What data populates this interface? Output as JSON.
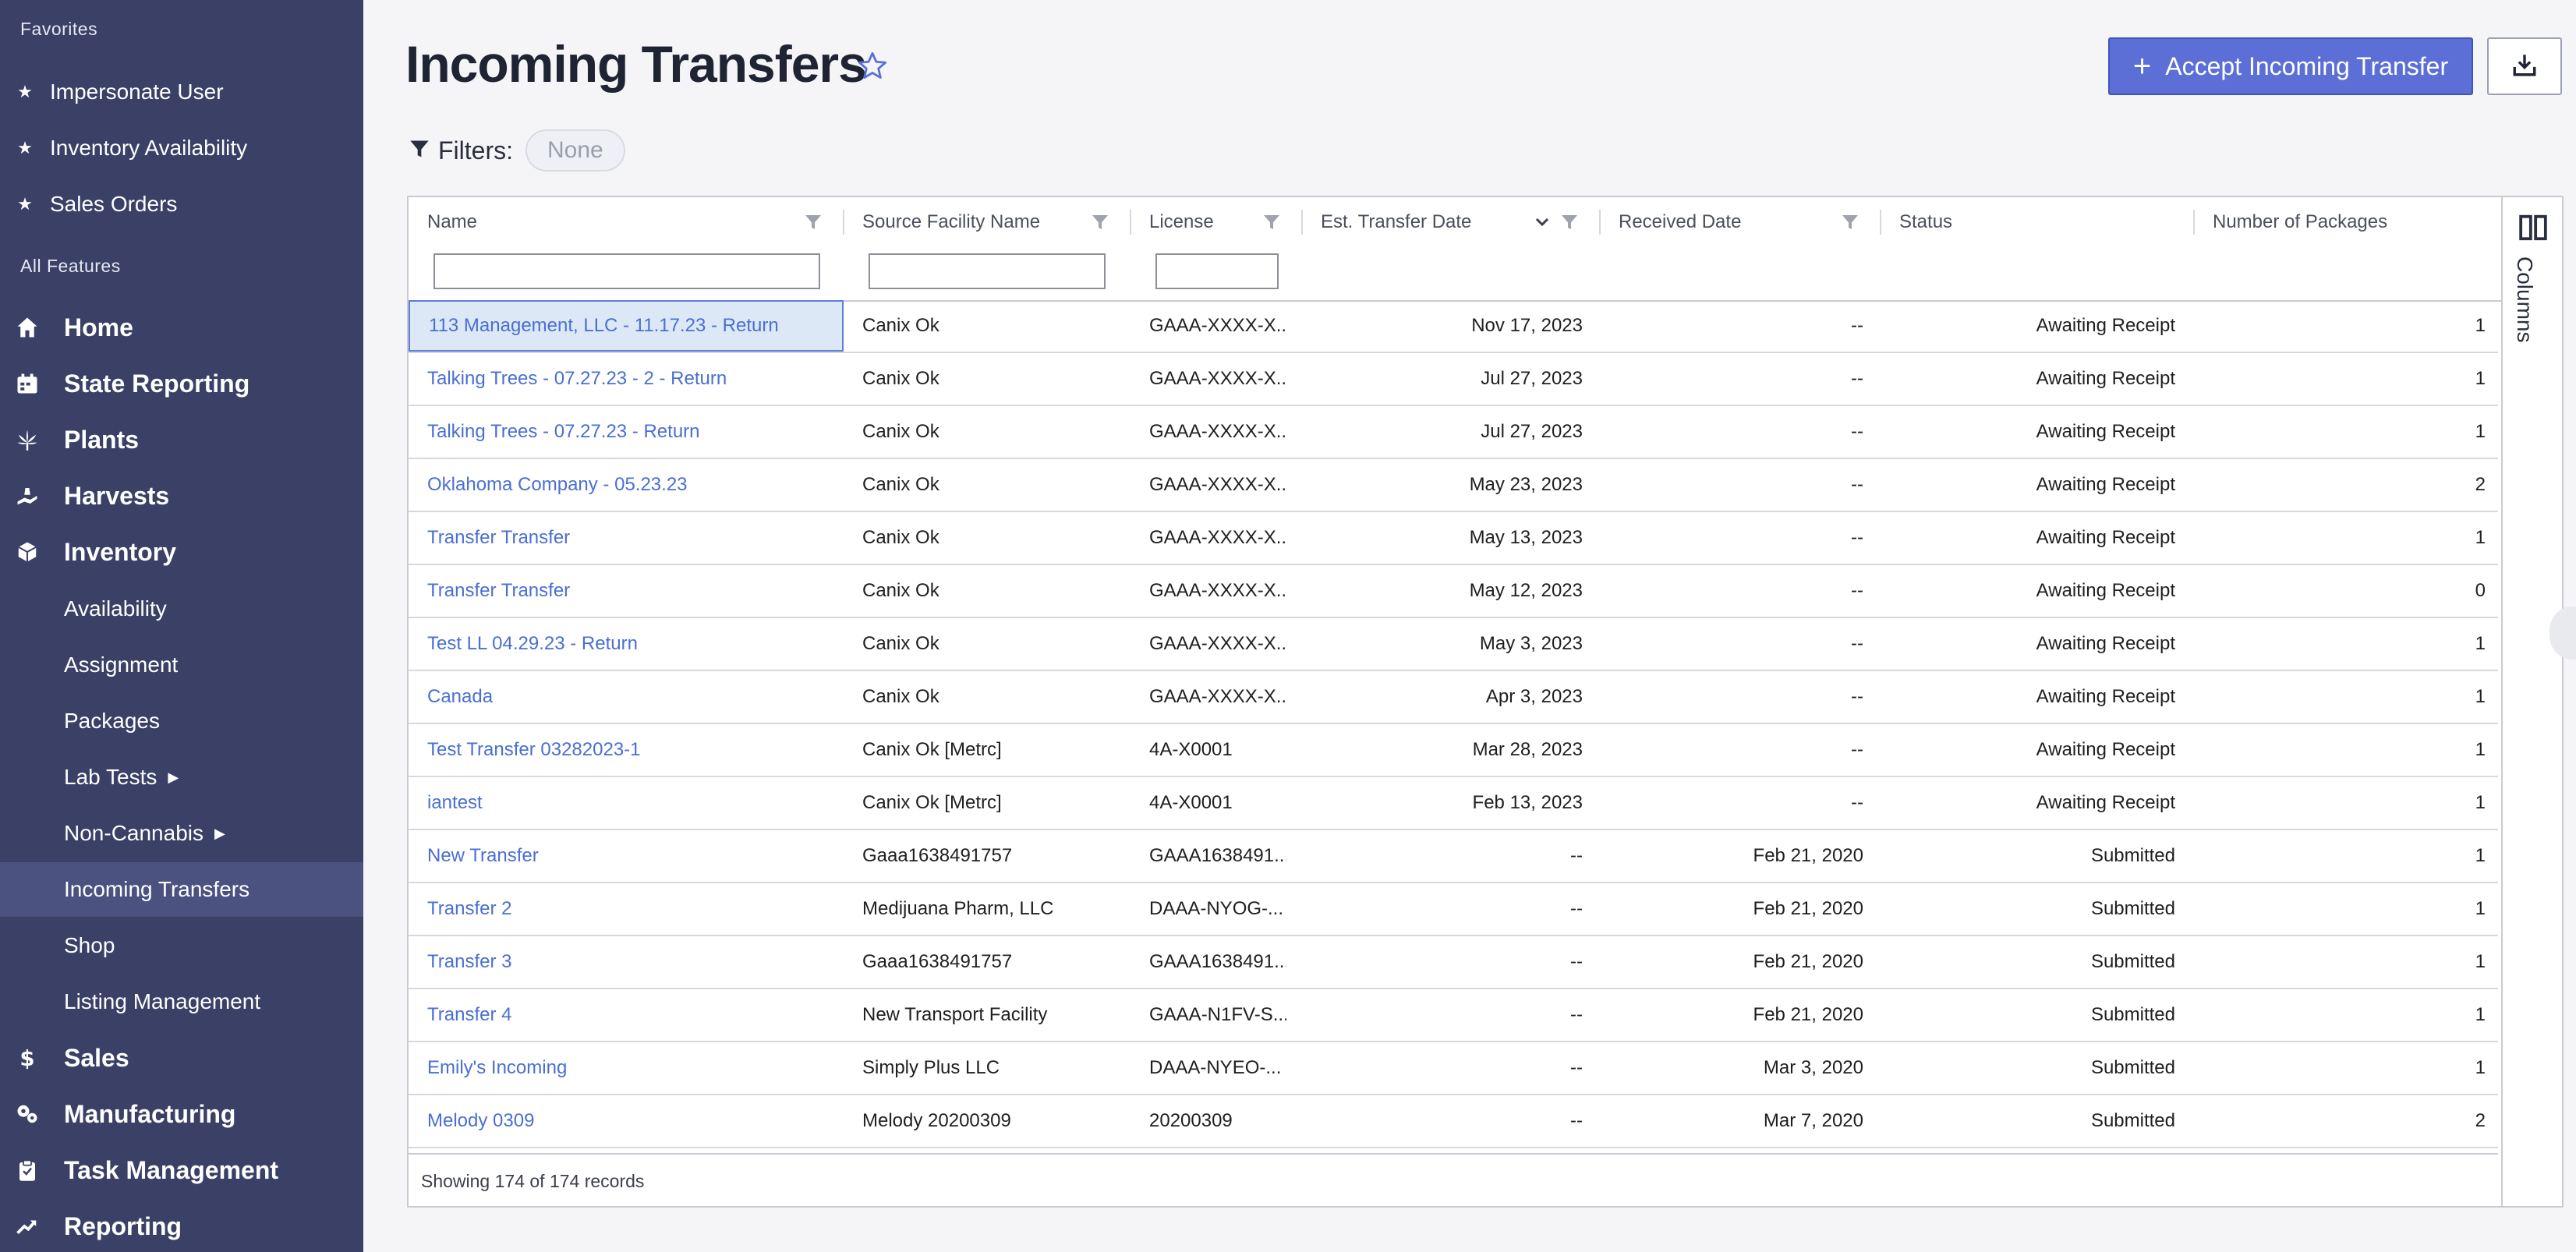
{
  "sidebar": {
    "favorites_title": "Favorites",
    "favorites": [
      {
        "label": "Impersonate User"
      },
      {
        "label": "Inventory Availability"
      },
      {
        "label": "Sales Orders"
      }
    ],
    "all_features_title": "All Features",
    "main_items": [
      {
        "label": "Home",
        "icon": "home-icon"
      },
      {
        "label": "State Reporting",
        "icon": "calendar-icon"
      },
      {
        "label": "Plants",
        "icon": "leaf-icon"
      },
      {
        "label": "Harvests",
        "icon": "harvest-icon"
      },
      {
        "label": "Inventory",
        "icon": "box-icon"
      }
    ],
    "inventory_sub": [
      {
        "label": "Availability",
        "caret": ""
      },
      {
        "label": "Assignment",
        "caret": ""
      },
      {
        "label": "Packages",
        "caret": ""
      },
      {
        "label": "Lab Tests",
        "caret": "▶"
      },
      {
        "label": "Non-Cannabis",
        "caret": "▶"
      },
      {
        "label": "Incoming Transfers",
        "caret": ""
      },
      {
        "label": "Shop",
        "caret": ""
      },
      {
        "label": "Listing Management",
        "caret": ""
      }
    ],
    "bottom_items": [
      {
        "label": "Sales",
        "icon": "dollar-icon"
      },
      {
        "label": "Manufacturing",
        "icon": "gears-icon"
      },
      {
        "label": "Task Management",
        "icon": "clipboard-icon"
      },
      {
        "label": "Reporting",
        "icon": "trend-icon"
      }
    ],
    "active_item": "Incoming Transfers"
  },
  "header": {
    "title": "Incoming Transfers",
    "accept_button": "Accept Incoming Transfer",
    "filters_label": "Filters:",
    "filters_value": "None"
  },
  "grid": {
    "columns": [
      "Name",
      "Source Facility Name",
      "License",
      "Est. Transfer Date",
      "Received Date",
      "Status",
      "Number of Packages"
    ],
    "rows": [
      {
        "name": "113 Management, LLC - 11.17.23 - Return",
        "source": "Canix Ok",
        "license": "GAAA-XXXX-X...",
        "est": "Nov 17, 2023",
        "received": "--",
        "status": "Awaiting Receipt",
        "packages": "1"
      },
      {
        "name": "Talking Trees - 07.27.23 - 2 - Return",
        "source": "Canix Ok",
        "license": "GAAA-XXXX-X...",
        "est": "Jul 27, 2023",
        "received": "--",
        "status": "Awaiting Receipt",
        "packages": "1"
      },
      {
        "name": "Talking Trees - 07.27.23 - Return",
        "source": "Canix Ok",
        "license": "GAAA-XXXX-X...",
        "est": "Jul 27, 2023",
        "received": "--",
        "status": "Awaiting Receipt",
        "packages": "1"
      },
      {
        "name": "Oklahoma Company - 05.23.23",
        "source": "Canix Ok",
        "license": "GAAA-XXXX-X...",
        "est": "May 23, 2023",
        "received": "--",
        "status": "Awaiting Receipt",
        "packages": "2"
      },
      {
        "name": "Transfer Transfer",
        "source": "Canix Ok",
        "license": "GAAA-XXXX-X...",
        "est": "May 13, 2023",
        "received": "--",
        "status": "Awaiting Receipt",
        "packages": "1"
      },
      {
        "name": "Transfer Transfer",
        "source": "Canix Ok",
        "license": "GAAA-XXXX-X...",
        "est": "May 12, 2023",
        "received": "--",
        "status": "Awaiting Receipt",
        "packages": "0"
      },
      {
        "name": "Test LL 04.29.23 - Return",
        "source": "Canix Ok",
        "license": "GAAA-XXXX-X...",
        "est": "May 3, 2023",
        "received": "--",
        "status": "Awaiting Receipt",
        "packages": "1"
      },
      {
        "name": "Canada",
        "source": "Canix Ok",
        "license": "GAAA-XXXX-X...",
        "est": "Apr 3, 2023",
        "received": "--",
        "status": "Awaiting Receipt",
        "packages": "1"
      },
      {
        "name": "Test Transfer 03282023-1",
        "source": "Canix Ok [Metrc]",
        "license": "4A-X0001",
        "est": "Mar 28, 2023",
        "received": "--",
        "status": "Awaiting Receipt",
        "packages": "1"
      },
      {
        "name": "iantest",
        "source": "Canix Ok [Metrc]",
        "license": "4A-X0001",
        "est": "Feb 13, 2023",
        "received": "--",
        "status": "Awaiting Receipt",
        "packages": "1"
      },
      {
        "name": "New Transfer",
        "source": "Gaaa1638491757",
        "license": "GAAA1638491...",
        "est": "--",
        "received": "Feb 21, 2020",
        "status": "Submitted",
        "packages": "1"
      },
      {
        "name": "Transfer 2",
        "source": "Medijuana Pharm, LLC",
        "license": "DAAA-NYOG-...",
        "est": "--",
        "received": "Feb 21, 2020",
        "status": "Submitted",
        "packages": "1"
      },
      {
        "name": "Transfer 3",
        "source": "Gaaa1638491757",
        "license": "GAAA1638491...",
        "est": "--",
        "received": "Feb 21, 2020",
        "status": "Submitted",
        "packages": "1"
      },
      {
        "name": "Transfer 4",
        "source": "New Transport Facility",
        "license": "GAAA-N1FV-S...",
        "est": "--",
        "received": "Feb 21, 2020",
        "status": "Submitted",
        "packages": "1"
      },
      {
        "name": "Emily's Incoming",
        "source": "Simply Plus LLC",
        "license": "DAAA-NYEO-...",
        "est": "--",
        "received": "Mar 3, 2020",
        "status": "Submitted",
        "packages": "1"
      },
      {
        "name": "Melody 0309",
        "source": "Melody 20200309",
        "license": "20200309",
        "est": "--",
        "received": "Mar 7, 2020",
        "status": "Submitted",
        "packages": "2"
      }
    ],
    "footer": "Showing 174 of 174 records",
    "columns_panel": "Columns"
  },
  "colors": {
    "sidebar_bg": "#3a4066",
    "sidebar_active": "#4b5280",
    "accent": "#5b6fd6",
    "link": "#4a6fd3"
  }
}
